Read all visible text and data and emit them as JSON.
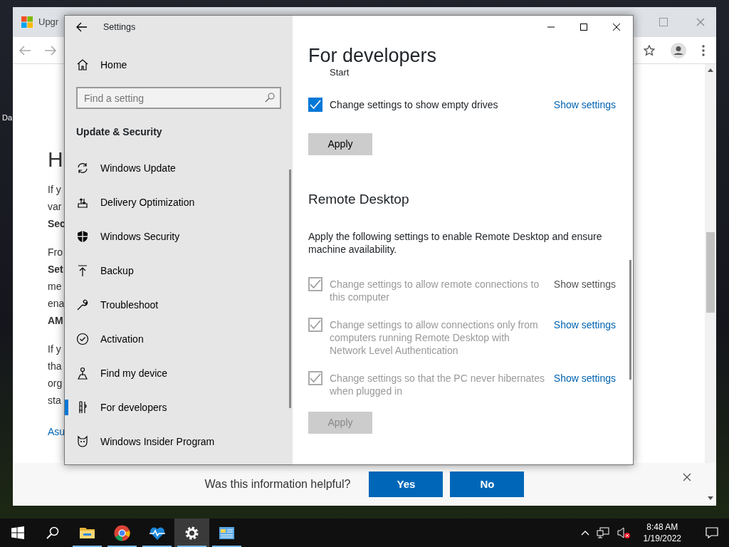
{
  "desktop": {
    "icon_label": "Da"
  },
  "browser": {
    "tab_title": "Upgr",
    "heading": "H",
    "paragraphs": [
      [
        {
          "text": "If y",
          "bold": false
        },
        {
          "text": "var",
          "bold": false
        },
        {
          "text": "Sec",
          "bold": true
        }
      ],
      [
        {
          "text": "Fro",
          "bold": false
        },
        {
          "text": "Set",
          "bold": true
        },
        {
          "text": "me",
          "bold": false
        },
        {
          "text": "ena",
          "bold": false
        },
        {
          "text": "AM",
          "bold": true
        }
      ],
      [
        {
          "text": "If y",
          "bold": false
        },
        {
          "text": "tha",
          "bold": false
        },
        {
          "text": "org",
          "bold": false
        },
        {
          "text": "sta",
          "bold": false
        }
      ]
    ],
    "link": "Asu",
    "feedback": {
      "question": "Was this information helpful?",
      "buttons": [
        "Yes",
        "No"
      ]
    }
  },
  "settings": {
    "title": "Settings",
    "home": "Home",
    "search": {
      "placeholder": "Find a setting"
    },
    "section": "Update & Security",
    "nav": [
      {
        "label": "Windows Update",
        "selected": false
      },
      {
        "label": "Delivery Optimization",
        "selected": false
      },
      {
        "label": "Windows Security",
        "selected": false
      },
      {
        "label": "Backup",
        "selected": false
      },
      {
        "label": "Troubleshoot",
        "selected": false
      },
      {
        "label": "Activation",
        "selected": false
      },
      {
        "label": "Find my device",
        "selected": false
      },
      {
        "label": "For developers",
        "selected": true
      },
      {
        "label": "Windows Insider Program",
        "selected": false
      }
    ],
    "page_title": "For developers",
    "cut_text": "Start",
    "groups": [
      {
        "rows": [
          {
            "label": "Change settings to show empty drives",
            "checked": true,
            "disabled": false,
            "link": {
              "text": "Show settings",
              "disabled": false
            }
          }
        ],
        "apply": {
          "text": "Apply",
          "disabled": false
        }
      },
      {
        "heading": "Remote Desktop",
        "description": "Apply the following settings to enable Remote Desktop and ensure machine availability.",
        "rows": [
          {
            "label": "Change settings to allow remote connections to this computer",
            "checked": true,
            "disabled": true,
            "link": {
              "text": "Show settings",
              "disabled": true
            }
          },
          {
            "label": "Change settings to allow connections only from computers running Remote Desktop with Network Level Authentication",
            "checked": true,
            "disabled": true,
            "link": {
              "text": "Show settings",
              "disabled": false
            }
          },
          {
            "label": "Change settings so that the PC never hibernates when plugged in",
            "checked": true,
            "disabled": true,
            "link": {
              "text": "Show settings",
              "disabled": false
            }
          }
        ],
        "apply": {
          "text": "Apply",
          "disabled": true
        }
      }
    ]
  },
  "taskbar": {
    "apps": [
      {
        "selected": false,
        "running": true
      },
      {
        "selected": false,
        "running": true
      },
      {
        "selected": false,
        "running": true
      },
      {
        "selected": true,
        "running": true
      },
      {
        "selected": false,
        "running": true
      }
    ],
    "time": "8:48 AM",
    "date": "1/19/2022"
  }
}
